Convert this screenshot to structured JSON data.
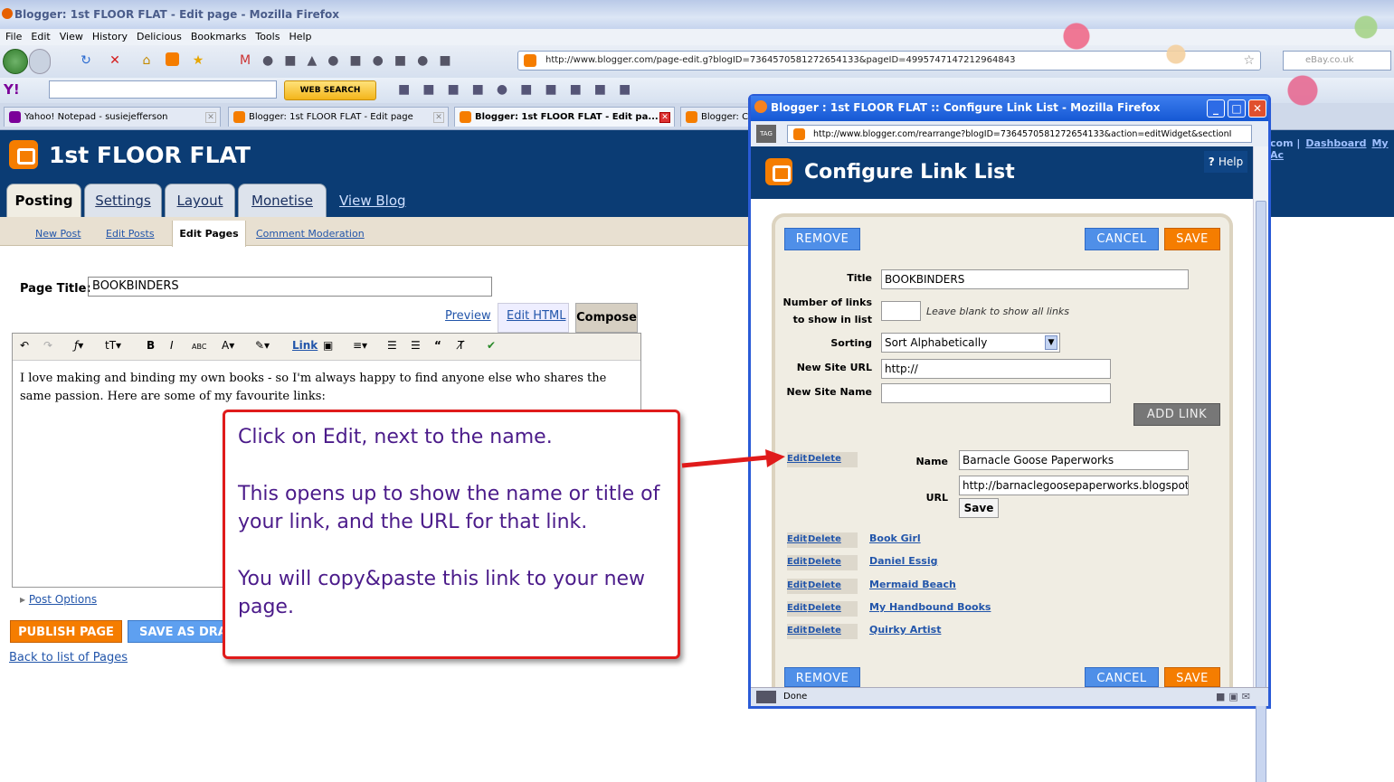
{
  "browser": {
    "window_title": "Blogger: 1st FLOOR FLAT - Edit page - Mozilla Firefox",
    "menu": [
      "File",
      "Edit",
      "View",
      "History",
      "Delicious",
      "Bookmarks",
      "Tools",
      "Help"
    ],
    "url": "http://www.blogger.com/page-edit.g?blogID=7364570581272654133&pageID=4995747147212964843",
    "search_engine_placeholder": "eBay.co.uk",
    "yahoo_search_button": "WEB SEARCH",
    "tabs": [
      {
        "label": "Yahoo! Notepad - susiejefferson"
      },
      {
        "label": "Blogger: 1st FLOOR FLAT - Edit page"
      },
      {
        "label": "Blogger: 1st FLOOR FLAT - Edit pa..."
      },
      {
        "label": "Blogger: C"
      }
    ]
  },
  "blogger": {
    "blog_title": "1st FLOOR FLAT",
    "main_tabs": [
      "Posting",
      "Settings",
      "Layout",
      "Monetise"
    ],
    "view_blog": "View Blog",
    "sub_tabs": [
      "New Post",
      "Edit Posts",
      "Edit Pages",
      "Comment Moderation"
    ],
    "right_links": {
      "prefix": "com |",
      "dashboard": "Dashboard",
      "account": "My Ac"
    },
    "page_title_label": "Page Title:",
    "page_title_value": "BOOKBINDERS",
    "modes": {
      "preview": "Preview",
      "edit_html": "Edit HTML",
      "compose": "Compose"
    },
    "editor_text": "I love making and binding my own books - so I'm always happy to find anyone else who shares the same passion. Here are some of my favourite links:",
    "toolbar_link": "Link",
    "post_options": "Post Options",
    "publish": "PUBLISH PAGE",
    "save_draft": "SAVE AS DRA",
    "back_to_list": "Back to list of Pages"
  },
  "popup": {
    "window_title": "Blogger : 1st FLOOR FLAT :: Configure Link List - Mozilla Firefox",
    "url": "http://www.blogger.com/rearrange?blogID=7364570581272654133&action=editWidget&sectionI",
    "heading": "Configure Link List",
    "help": "Help",
    "remove": "REMOVE",
    "cancel": "CANCEL",
    "save": "SAVE",
    "title_label": "Title",
    "title_value": "BOOKBINDERS",
    "num_links_label_1": "Number of links",
    "num_links_label_2": "to show in list",
    "num_links_hint": "Leave blank to show all links",
    "sorting_label": "Sorting",
    "sorting_value": "Sort Alphabetically",
    "new_url_label": "New Site URL",
    "new_url_value": "http://",
    "new_name_label": "New Site Name",
    "add_link": "ADD LINK",
    "edit": "Edit",
    "delete": "Delete",
    "name_label": "Name",
    "name_value": "Barnacle Goose Paperworks",
    "url_label": "URL",
    "url_value": "http://barnaclegoosepaperworks.blogspot",
    "save_small": "Save",
    "links": [
      "Book Girl",
      "Daniel Essig",
      "Mermaid Beach",
      "My Handbound Books",
      "Quirky Artist"
    ],
    "status": "Done"
  },
  "callout": {
    "line1": "Click on Edit, next to the name.",
    "line2": "This opens up to show the name or title of your link, and the URL for that link.",
    "line3": "You will copy&paste this link to your new page."
  },
  "colors": {
    "blogger_blue": "#0b3c74",
    "blogger_orange": "#f57d00",
    "callout_border": "#e01b1b",
    "callout_text": "#4b1b8a"
  }
}
